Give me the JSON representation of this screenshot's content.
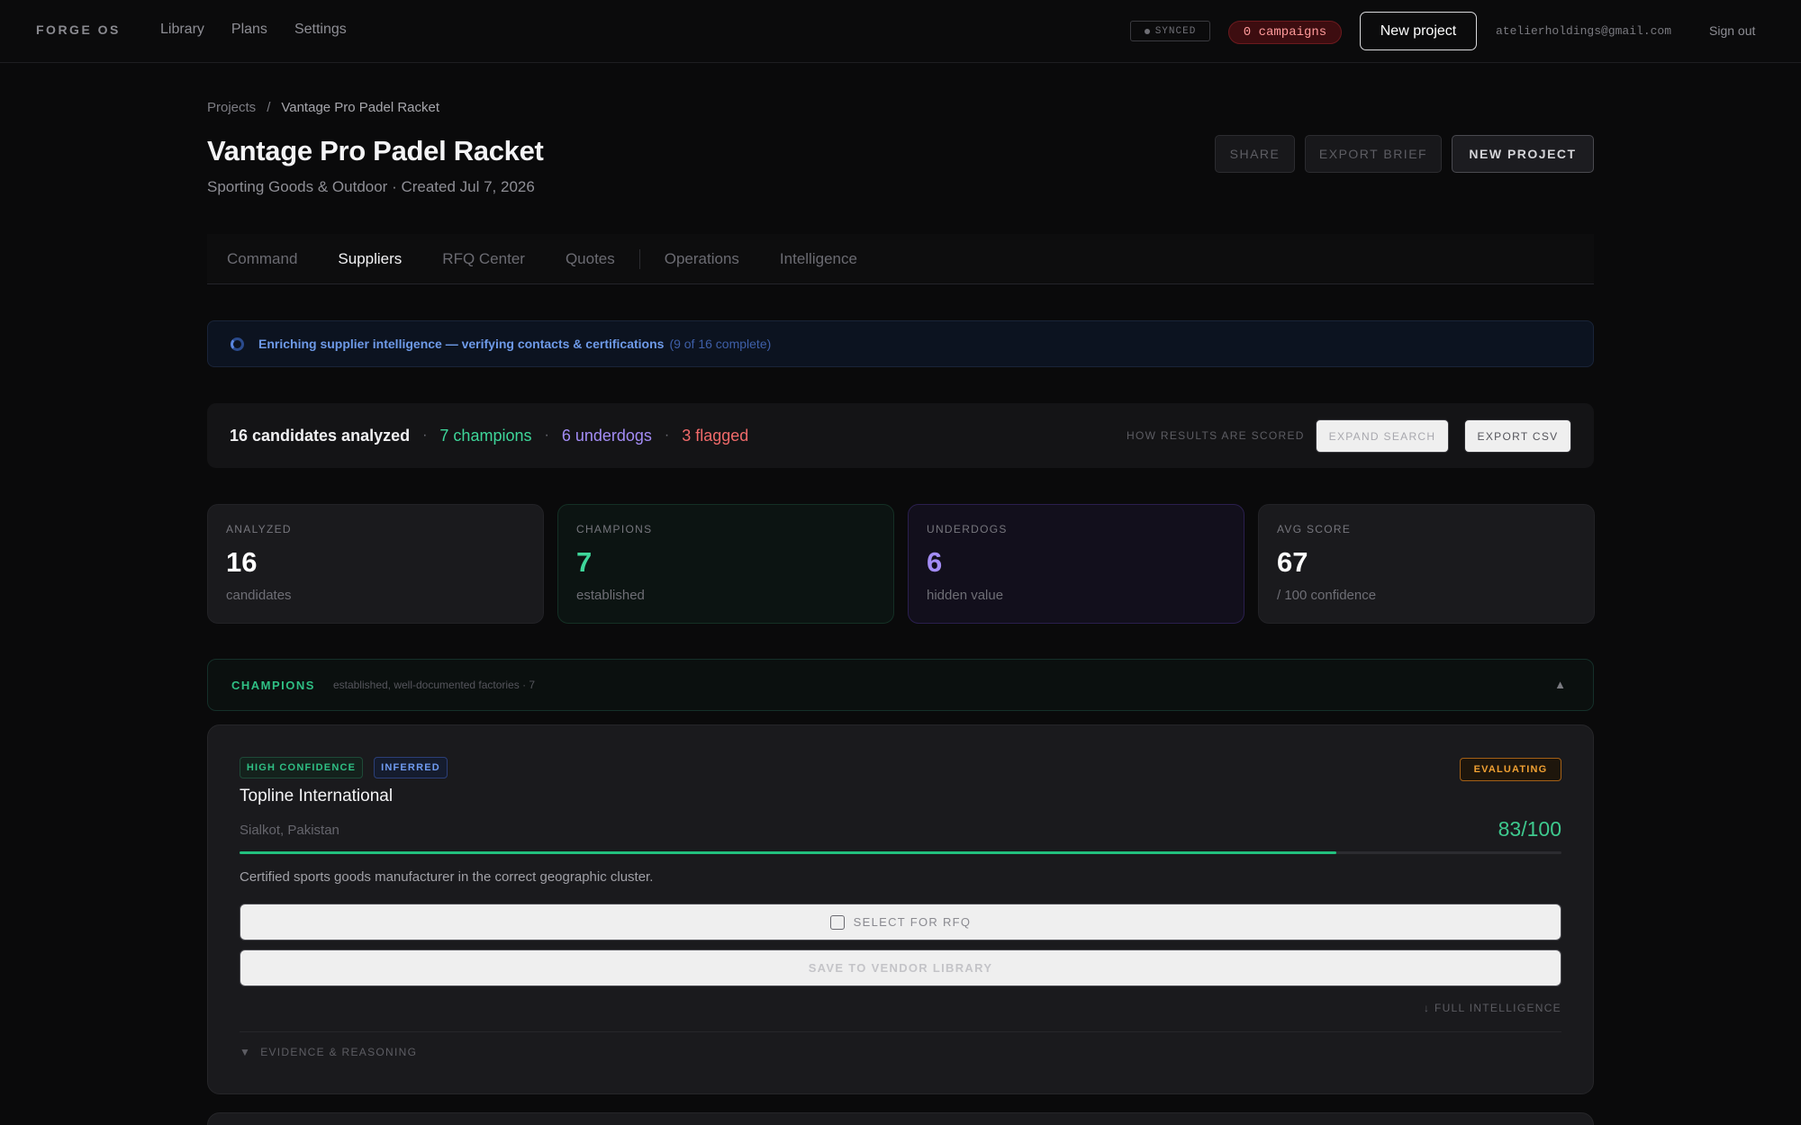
{
  "nav": {
    "brand": "FORGE OS",
    "links": [
      "Library",
      "Plans",
      "Settings"
    ],
    "synced": "SYNCED",
    "campaigns": "0 campaigns",
    "new_project": "New project",
    "email": "atelierholdings@gmail.com",
    "sign_out": "Sign out"
  },
  "breadcrumb": {
    "root": "Projects",
    "separator": "/",
    "current": "Vantage Pro Padel Racket"
  },
  "header": {
    "title": "Vantage Pro Padel Racket",
    "subtitle": "Sporting Goods & Outdoor · Created Jul 7, 2026",
    "share": "SHARE",
    "export_brief": "EXPORT BRIEF",
    "new_project": "NEW PROJECT"
  },
  "tabs": [
    {
      "label": "Command",
      "active": false
    },
    {
      "label": "Suppliers",
      "active": true
    },
    {
      "label": "RFQ Center",
      "active": false
    },
    {
      "label": "Quotes",
      "active": false
    },
    {
      "label": "Operations",
      "active": false
    },
    {
      "label": "Intelligence",
      "active": false
    }
  ],
  "banner": {
    "message": "Enriching supplier intelligence — verifying contacts & certifications",
    "progress": "(9 of 16 complete)"
  },
  "summary": {
    "total": "16 candidates analyzed",
    "dot": "·",
    "champions": "7 champions",
    "underdogs": "6 underdogs",
    "flagged": "3 flagged",
    "how_scored": "HOW RESULTS ARE SCORED",
    "expand_search": "EXPAND SEARCH",
    "export_csv": "EXPORT CSV"
  },
  "stats": [
    {
      "label": "ANALYZED",
      "value": "16",
      "caption": "candidates"
    },
    {
      "label": "CHAMPIONS",
      "value": "7",
      "caption": "established"
    },
    {
      "label": "UNDERDOGS",
      "value": "6",
      "caption": "hidden value"
    },
    {
      "label": "AVG SCORE",
      "value": "67",
      "caption": "/ 100 confidence"
    }
  ],
  "section": {
    "name": "CHAMPIONS",
    "description": "established, well-documented factories · 7",
    "caret": "▲"
  },
  "supplier": {
    "badge_confidence": "HIGH CONFIDENCE",
    "badge_inferred": "INFERRED",
    "status": "EVALUATING",
    "name": "Topline International",
    "location": "Sialkot, Pakistan",
    "score_text": "83/100",
    "score": 83,
    "description": "Certified sports goods manufacturer in the correct geographic cluster.",
    "select_rfq": "SELECT FOR RFQ",
    "save_vendor": "SAVE TO VENDOR LIBRARY",
    "full_intel": "↓ FULL INTELLIGENCE",
    "evidence": "EVIDENCE & REASONING",
    "evidence_icon": "▼"
  },
  "colors": {
    "champion": "#3ed69a",
    "underdog": "#a38cf5",
    "flagged": "#f06a6a",
    "evaluating": "#f0a032",
    "info": "#6e9ae8"
  }
}
